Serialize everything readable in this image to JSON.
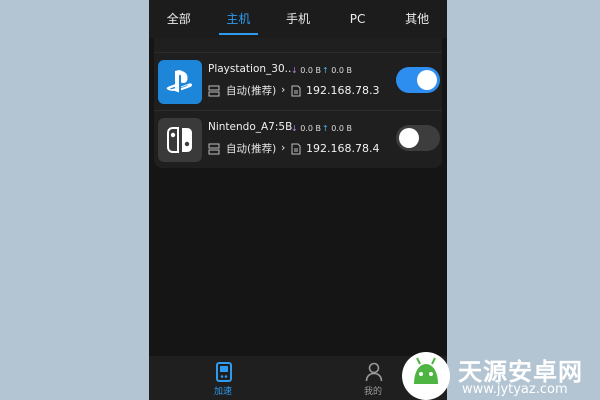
{
  "tabs": [
    {
      "label": "全部",
      "active": false
    },
    {
      "label": "主机",
      "active": true
    },
    {
      "label": "手机",
      "active": false
    },
    {
      "label": "PC",
      "active": false
    },
    {
      "label": "其他",
      "active": false
    }
  ],
  "devices": [
    {
      "name": "Playstation_30..",
      "download": "0.0 B",
      "upload": "0.0 B",
      "mode": "自动(推荐)",
      "ip": "192.168.78.3",
      "enabled": true,
      "icon": "playstation-icon"
    },
    {
      "name": "Nintendo_A7:5B",
      "download": "0.0 B",
      "upload": "0.0 B",
      "mode": "自动(推荐)",
      "ip": "192.168.78.4",
      "enabled": false,
      "icon": "nintendo-switch-icon"
    }
  ],
  "bottom_nav": [
    {
      "label": "加速",
      "icon": "gamepad-icon",
      "active": true
    },
    {
      "label": "我的",
      "icon": "user-icon",
      "active": false
    }
  ],
  "watermark": {
    "title": "天源安卓网",
    "url": "www.jytyaz.com"
  },
  "colors": {
    "accent": "#2e9bf0",
    "background": "#151515",
    "card": "#1f1f1f",
    "download": "#b47fe6",
    "upload": "#3fb6e8"
  }
}
